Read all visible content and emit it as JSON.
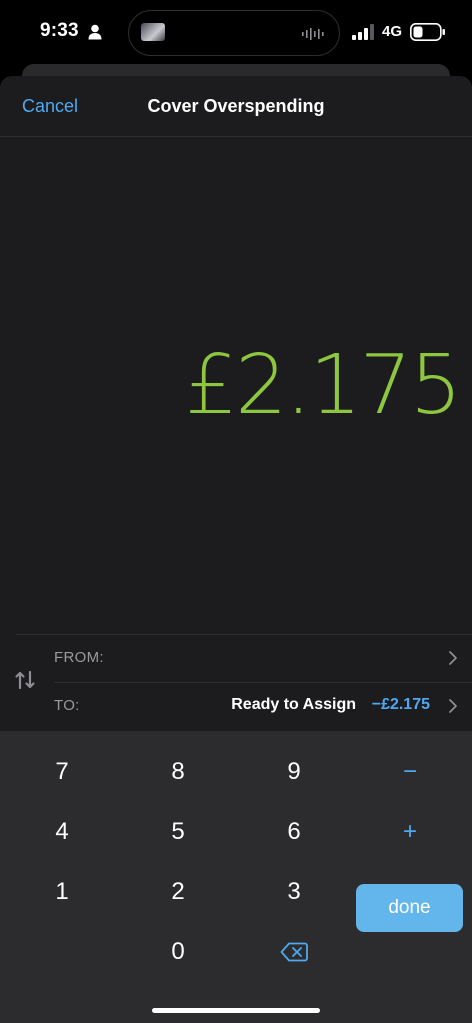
{
  "status": {
    "time": "9:33",
    "network": "4G",
    "icons": [
      "person-icon",
      "signal-icon",
      "battery-icon",
      "audio-wave-icon"
    ]
  },
  "nav": {
    "cancel_label": "Cancel",
    "title": "Cover Overspending"
  },
  "amount": "£2.175",
  "transfer": {
    "from_label": "FROM:",
    "from_value": "",
    "to_label": "TO:",
    "to_value": "Ready to Assign",
    "to_amount": "−£2.175"
  },
  "keypad": {
    "rows": [
      [
        "7",
        "8",
        "9",
        "−"
      ],
      [
        "4",
        "5",
        "6",
        "+"
      ],
      [
        "1",
        "2",
        "3",
        "="
      ],
      [
        "",
        "0",
        "backspace",
        "done"
      ]
    ],
    "done_label": "done"
  },
  "colors": {
    "accent": "#4fa9f0",
    "amount": "#8dc63f",
    "done_button": "#62b6ec",
    "sheet_bg": "#1c1c1e",
    "keypad_bg": "#2c2c2e"
  }
}
